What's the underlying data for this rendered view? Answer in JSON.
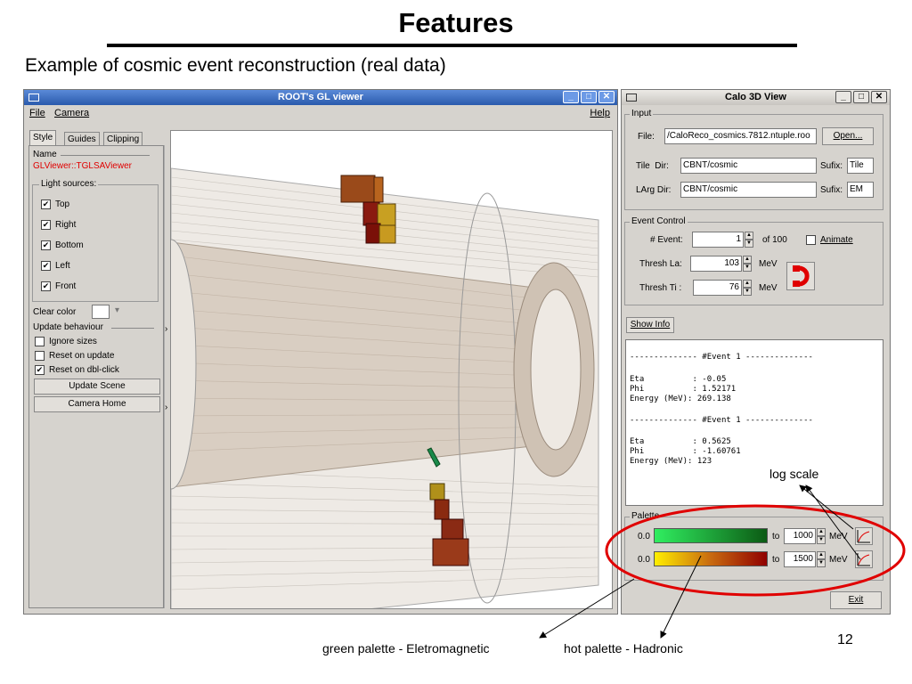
{
  "slide": {
    "title": "Features",
    "subtitle": "Example of cosmic event reconstruction (real data)",
    "page_number": "12"
  },
  "gl_viewer": {
    "title": "ROOT's GL viewer",
    "menu": {
      "file": "File",
      "camera": "Camera",
      "help": "Help"
    },
    "tabs": [
      "Style",
      "Guides",
      "Clipping"
    ],
    "name_label": "Name",
    "name_value": "GLViewer::TGLSAViewer",
    "light_sources": {
      "label": "Light sources:",
      "items": [
        {
          "label": "Top",
          "checked": "✔"
        },
        {
          "label": "Right",
          "checked": "✔"
        },
        {
          "label": "Bottom",
          "checked": "✔"
        },
        {
          "label": "Left",
          "checked": "✔"
        },
        {
          "label": "Front",
          "checked": "✔"
        }
      ]
    },
    "clear_color_label": "Clear color",
    "update_behaviour": {
      "label": "Update behaviour",
      "items": [
        {
          "label": "Ignore sizes",
          "checked": ""
        },
        {
          "label": "Reset on update",
          "checked": ""
        },
        {
          "label": "Reset on dbl-click",
          "checked": "✔"
        }
      ]
    },
    "update_scene_button": "Update Scene",
    "camera_home_button": "Camera Home"
  },
  "calo_view": {
    "title": "Calo 3D View",
    "input": {
      "label": "Input",
      "file_label": "File:",
      "file_value": "/CaloReco_cosmics.7812.ntuple.roo",
      "open_button": "Open...",
      "tile_dir_label": "Tile  Dir:",
      "tile_dir_value": "CBNT/cosmic",
      "tile_sufix_label": "Sufix:",
      "tile_sufix_value": "Tile",
      "larg_dir_label": "LArg Dir:",
      "larg_dir_value": "CBNT/cosmic",
      "larg_sufix_label": "Sufix:",
      "larg_sufix_value": "EM"
    },
    "event_control": {
      "label": "Event Control",
      "event_label": "# Event:",
      "event_value": "1",
      "of_label": "of 100",
      "animate_label": "Animate",
      "thresh_la_label": "Thresh La:",
      "thresh_la_value": "103",
      "thresh_ti_label": "Thresh Ti :",
      "thresh_ti_value": "76",
      "unit": "MeV"
    },
    "show_info_button": "Show Info",
    "info_lines": [
      "-------------- #Event 1 --------------",
      "",
      "Eta          : -0.05",
      "Phi          : 1.52171",
      "Energy (MeV): 269.138",
      "",
      "-------------- #Event 1 --------------",
      "",
      "Eta          : 0.5625",
      "Phi          : -1.60761",
      "Energy (MeV): 123"
    ],
    "palette": {
      "label": "Palette",
      "rows": [
        {
          "min": "0.0",
          "to": "to",
          "max": "1000",
          "unit": "MeV"
        },
        {
          "min": "0.0",
          "to": "to",
          "max": "1500",
          "unit": "MeV"
        }
      ]
    },
    "exit_button": "Exit"
  },
  "annotations": {
    "log_scale": "log scale",
    "green_palette": "green palette - Eletromagnetic",
    "hot_palette": "hot palette - Hadronic"
  },
  "colors": {
    "accent_red": "#e00000",
    "green_start": "#30ee60",
    "green_end": "#0c5a14",
    "hot_start": "#ffee00",
    "hot_end": "#900000"
  }
}
